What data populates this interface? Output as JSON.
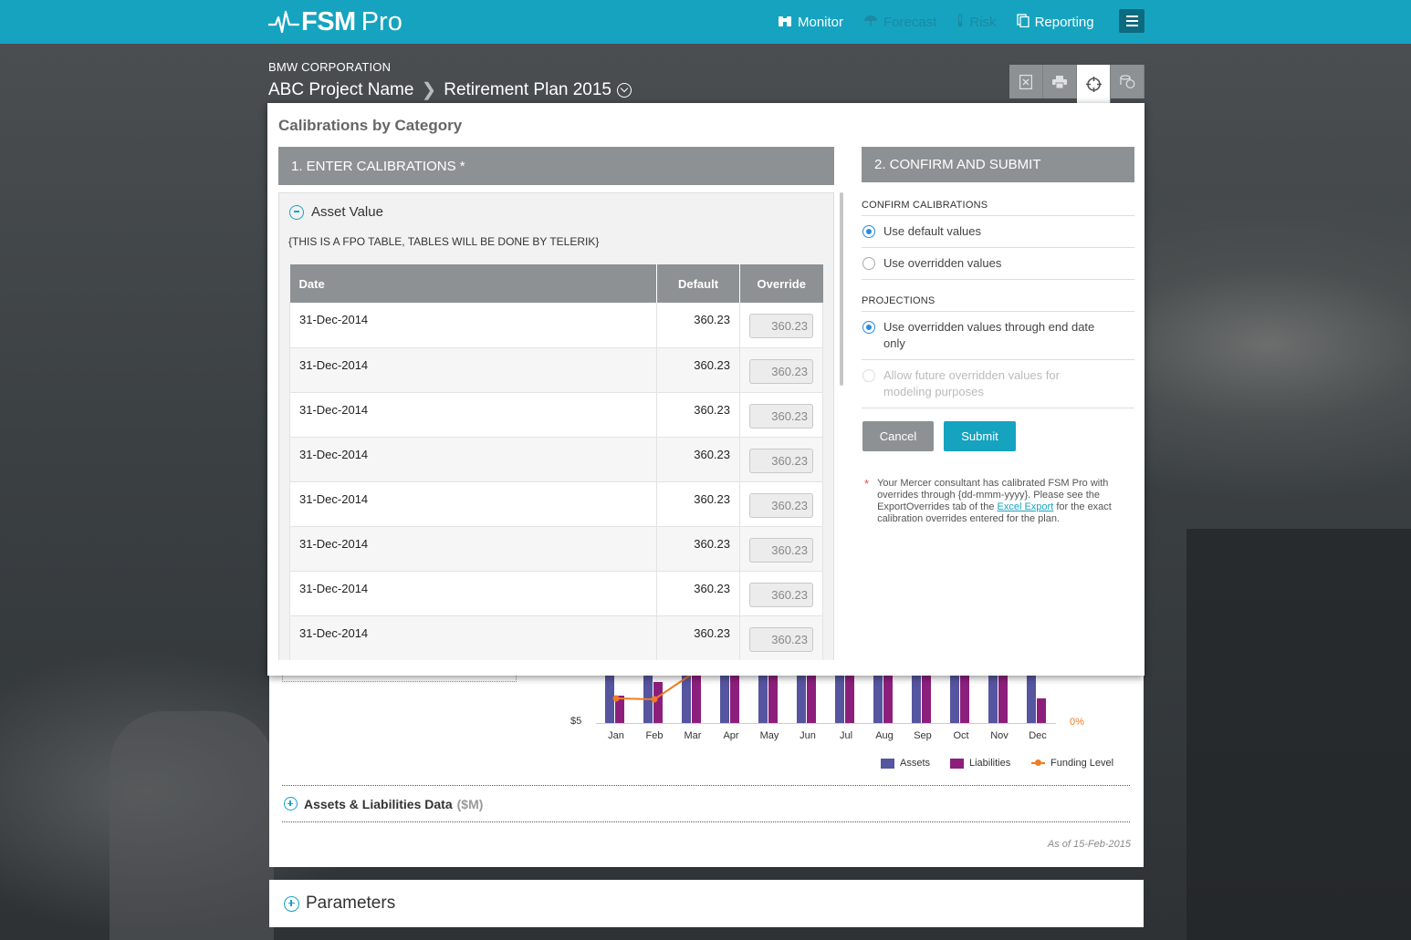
{
  "app": {
    "brand": "FSM",
    "brand_suffix": "Pro"
  },
  "nav": {
    "items": [
      {
        "label": "Monitor",
        "icon": "binoculars-icon",
        "active": true
      },
      {
        "label": "Forecast",
        "icon": "umbrella-icon",
        "active": false
      },
      {
        "label": "Risk",
        "icon": "thermometer-icon",
        "active": false
      },
      {
        "label": "Reporting",
        "icon": "documents-icon",
        "active": true
      }
    ]
  },
  "header": {
    "company": "BMW CORPORATION",
    "project": "ABC Project Name",
    "plan": "Retirement Plan 2015"
  },
  "toolbar": {
    "tools": [
      "excel-icon",
      "print-icon",
      "crosshair-icon",
      "coins-icon"
    ]
  },
  "modal": {
    "title": "Calibrations by Category",
    "left_header": "1. ENTER CALIBRATIONS *",
    "accordion_title": "Asset Value",
    "fpo_note": "{THIS IS A FPO TABLE, TABLES WILL BE DONE BY TELERIK}",
    "table": {
      "columns": [
        "Date",
        "Default",
        "Override"
      ],
      "rows": [
        {
          "date": "31-Dec-2014",
          "default": "360.23",
          "override": "360.23"
        },
        {
          "date": "31-Dec-2014",
          "default": "360.23",
          "override": "360.23"
        },
        {
          "date": "31-Dec-2014",
          "default": "360.23",
          "override": "360.23"
        },
        {
          "date": "31-Dec-2014",
          "default": "360.23",
          "override": "360.23"
        },
        {
          "date": "31-Dec-2014",
          "default": "360.23",
          "override": "360.23"
        },
        {
          "date": "31-Dec-2014",
          "default": "360.23",
          "override": "360.23"
        },
        {
          "date": "31-Dec-2014",
          "default": "360.23",
          "override": "360.23"
        },
        {
          "date": "31-Dec-2014",
          "default": "360.23",
          "override": "360.23"
        }
      ]
    },
    "right_header": "2. CONFIRM AND SUBMIT",
    "confirm": {
      "label": "CONFIRM CALIBRATIONS",
      "options": [
        {
          "label": "Use default values",
          "selected": true
        },
        {
          "label": "Use overridden values",
          "selected": false
        }
      ]
    },
    "projections": {
      "label": "PROJECTIONS",
      "options": [
        {
          "label": "Use overridden values through end date only",
          "selected": true,
          "disabled": false
        },
        {
          "label": "Allow future overridden values for modeling purposes",
          "selected": false,
          "disabled": true
        }
      ]
    },
    "cancel_label": "Cancel",
    "submit_label": "Submit",
    "note_before": "Your Mercer consultant has calibrated FSM Pro with overrides through {dd-mmm-yyyy}. Please see the ExportOverrides tab of the ",
    "note_link": "Excel Export",
    "note_after": " for the exact calibration overrides entered for the plan."
  },
  "chart_data": {
    "type": "bar",
    "categories": [
      "Jan",
      "Feb",
      "Mar",
      "Apr",
      "May",
      "Jun",
      "Jul",
      "Aug",
      "Sep",
      "Oct",
      "Nov",
      "Dec"
    ],
    "y_tick_label": "$5",
    "y2_tick_label": "0%",
    "series": [
      {
        "name": "Assets",
        "color": "#5555a0"
      },
      {
        "name": "Liabilities",
        "color": "#8c1f7c"
      },
      {
        "name": "Funding Level",
        "color": "#f07c24"
      }
    ],
    "legend_position": "bottom-right"
  },
  "lower": {
    "section_title": "Assets & Liabilities Data",
    "section_units": "($M)",
    "as_of": "As of 15-Feb-2015",
    "parameters_title": "Parameters"
  }
}
